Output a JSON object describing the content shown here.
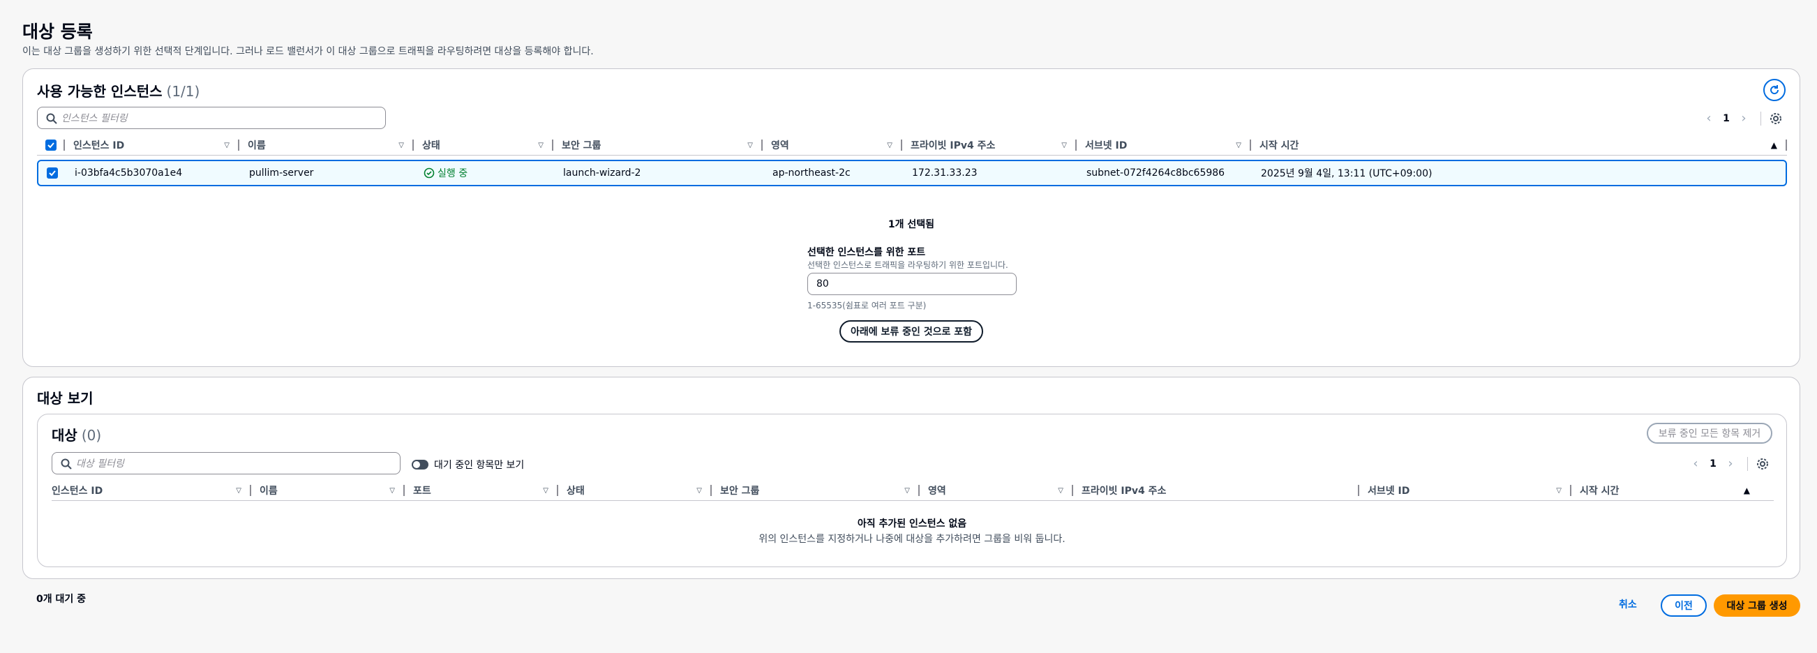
{
  "page": {
    "title": "대상 등록",
    "description": "이는 대상 그룹을 생성하기 위한 선택적 단계입니다. 그러나 로드 밸런서가 이 대상 그룹으로 트래픽을 라우팅하려면 대상을 등록해야 합니다."
  },
  "available": {
    "title": "사용 가능한 인스턴스",
    "count": "(1/1)",
    "search_placeholder": "인스턴스 필터링",
    "page": "1",
    "columns": [
      "인스턴스 ID",
      "이름",
      "상태",
      "보안 그룹",
      "영역",
      "프라이빗 IPv4 주소",
      "서브넷 ID",
      "시작 시간"
    ],
    "row": {
      "instance_id": "i-03bfa4c5b3070a1e4",
      "name": "pullim-server",
      "status": "실행 중",
      "security_group": "launch-wizard-2",
      "zone": "ap-northeast-2c",
      "private_ip": "172.31.33.23",
      "subnet_id": "subnet-072f4264c8bc65986",
      "start_time": "2025년 9월 4일, 13:11 (UTC+09:00)"
    },
    "selected_count": "1개 선택됨",
    "port_label": "선택한 인스턴스를 위한 포트",
    "port_desc": "선택한 인스턴스로 트래픽을 라우팅하기 위한 포트입니다.",
    "port_value": "80",
    "port_hint": "1-65535(쉼표로 여러 포트 구분)",
    "include_button": "아래에 보류 중인 것으로 포함"
  },
  "review": {
    "title": "대상 보기",
    "targets_title": "대상",
    "targets_count": "(0)",
    "remove_all_button": "보류 중인 모든 항목 제거",
    "search_placeholder": "대상 필터링",
    "toggle_label": "대기 중인 항목만 보기",
    "page": "1",
    "columns": [
      "인스턴스 ID",
      "이름",
      "포트",
      "상태",
      "보안 그룹",
      "영역",
      "프라이빗 IPv4 주소",
      "서브넷 ID",
      "시작 시간"
    ],
    "empty_title": "아직 추가된 인스턴스 없음",
    "empty_desc": "위의 인스턴스를 지정하거나 나중에 대상을 추가하려면 그룹을 비워 둡니다."
  },
  "footer": {
    "pending_count": "0개 대기 중",
    "cancel": "취소",
    "previous": "이전",
    "create": "대상 그룹 생성"
  },
  "colors": {
    "accent": "#006ce0",
    "success": "#00802f",
    "primary_button": "#ff9900"
  }
}
